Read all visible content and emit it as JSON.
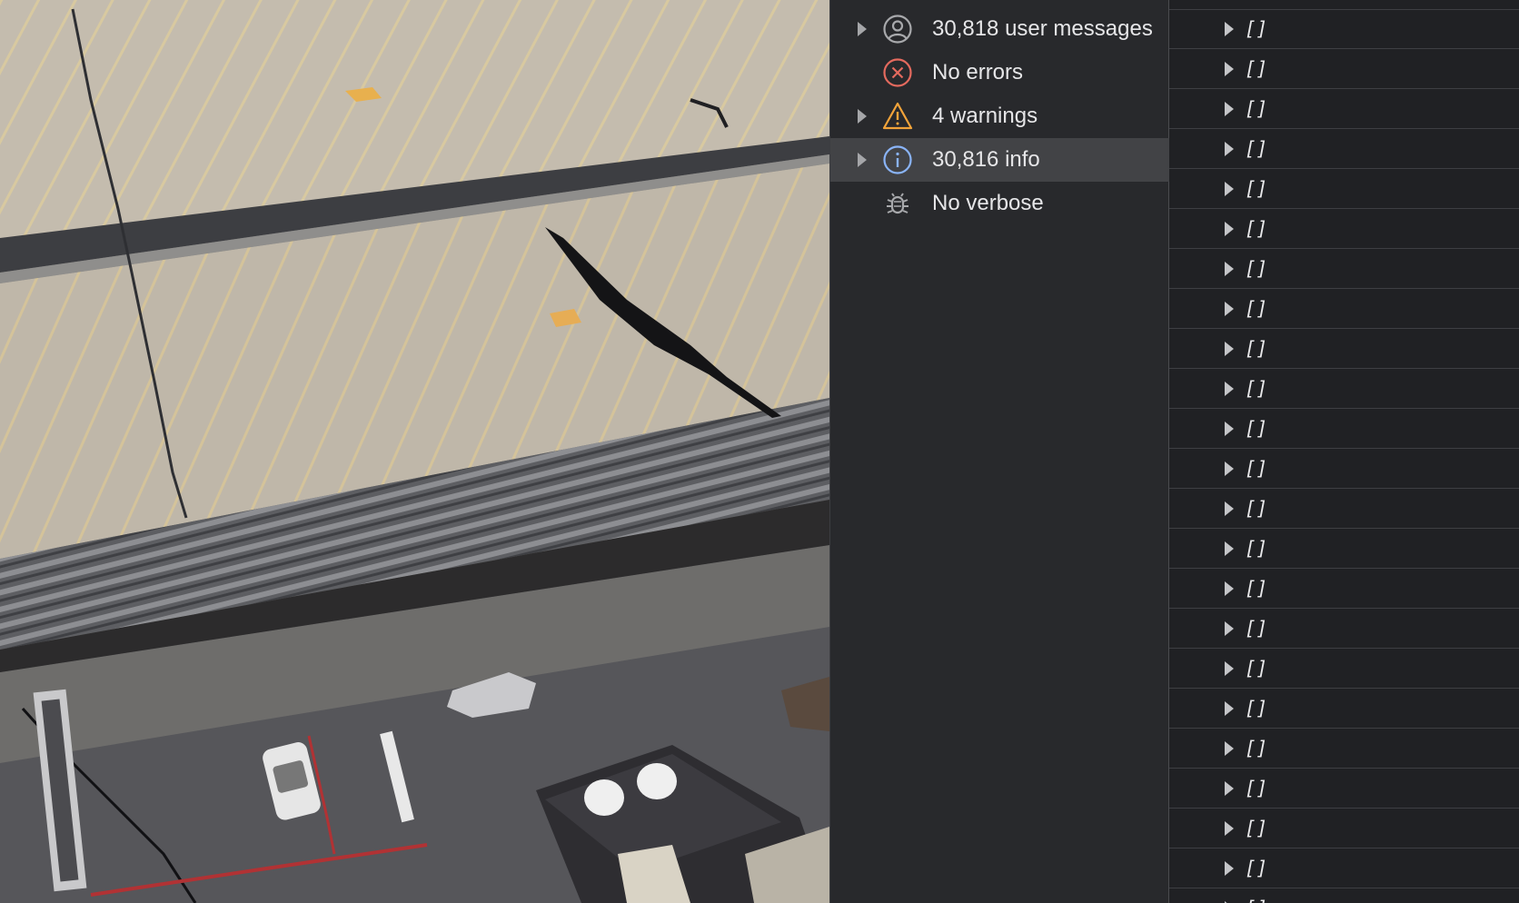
{
  "sidebar": {
    "filters": [
      {
        "label": "30,818 user messages",
        "icon": "user-circle-icon",
        "expandable": true,
        "selected": false
      },
      {
        "label": "No errors",
        "icon": "error-circle-icon",
        "expandable": false,
        "selected": false
      },
      {
        "label": "4 warnings",
        "icon": "warning-triangle-icon",
        "expandable": true,
        "selected": false
      },
      {
        "label": "30,816 info",
        "icon": "info-circle-icon",
        "expandable": true,
        "selected": true
      },
      {
        "label": "No verbose",
        "icon": "bug-icon",
        "expandable": false,
        "selected": false
      }
    ]
  },
  "log": {
    "rows": [
      {
        "text": "[]"
      },
      {
        "text": "[]"
      },
      {
        "text": "[]"
      },
      {
        "text": "[]"
      },
      {
        "text": "[]"
      },
      {
        "text": "[]"
      },
      {
        "text": "[]"
      },
      {
        "text": "[]"
      },
      {
        "text": "[]"
      },
      {
        "text": "[]"
      },
      {
        "text": "[]"
      },
      {
        "text": "[]"
      },
      {
        "text": "[]"
      },
      {
        "text": "[]"
      },
      {
        "text": "[]"
      },
      {
        "text": "[]"
      },
      {
        "text": "[]"
      },
      {
        "text": "[]"
      },
      {
        "text": "[]"
      },
      {
        "text": "[]"
      },
      {
        "text": "[]"
      },
      {
        "text": "[]"
      },
      {
        "text": "[]"
      },
      {
        "text": "[]"
      }
    ]
  },
  "colors": {
    "error": "#e46a5e",
    "warning": "#f2a33a",
    "info": "#8ab4f8",
    "neutral_icon": "#a8a9ac",
    "sidebar_bg": "#28292c",
    "selected_bg": "#424346",
    "log_bg": "#202124"
  }
}
